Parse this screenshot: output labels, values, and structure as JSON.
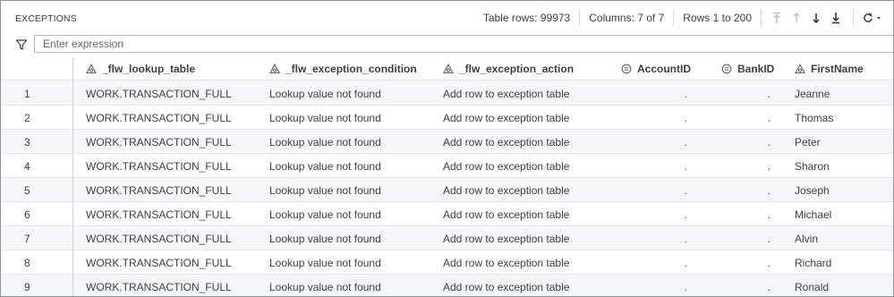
{
  "panel": {
    "title": "EXCEPTIONS",
    "table_rows": "Table rows: 99973",
    "columns": "Columns: 7 of 7",
    "rows_range": "Rows 1 to 200",
    "nav_icons": [
      "first-page-icon",
      "previous-page-icon",
      "next-page-icon",
      "last-page-icon"
    ],
    "refresh_icon": "refresh-icon"
  },
  "filter": {
    "icon": "filter-icon",
    "placeholder": "Enter expression",
    "value": ""
  },
  "columns": [
    {
      "name": "_flw_lookup_table",
      "type": "character"
    },
    {
      "name": "_flw_exception_condition",
      "type": "character"
    },
    {
      "name": "_flw_exception_action",
      "type": "character"
    },
    {
      "name": "AccountID",
      "type": "numeric"
    },
    {
      "name": "BankID",
      "type": "numeric"
    },
    {
      "name": "FirstName",
      "type": "character"
    }
  ],
  "rows": [
    {
      "n": "1",
      "lookup": "WORK.TRANSACTION_FULL",
      "condition": "Lookup value not found",
      "action": "Add row to exception table",
      "account": ".",
      "bank": ".",
      "first": "Jeanne"
    },
    {
      "n": "2",
      "lookup": "WORK.TRANSACTION_FULL",
      "condition": "Lookup value not found",
      "action": "Add row to exception table",
      "account": ".",
      "bank": ".",
      "first": "Thomas"
    },
    {
      "n": "3",
      "lookup": "WORK.TRANSACTION_FULL",
      "condition": "Lookup value not found",
      "action": "Add row to exception table",
      "account": ".",
      "bank": ".",
      "first": "Peter"
    },
    {
      "n": "4",
      "lookup": "WORK.TRANSACTION_FULL",
      "condition": "Lookup value not found",
      "action": "Add row to exception table",
      "account": ".",
      "bank": ".",
      "first": "Sharon"
    },
    {
      "n": "5",
      "lookup": "WORK.TRANSACTION_FULL",
      "condition": "Lookup value not found",
      "action": "Add row to exception table",
      "account": ".",
      "bank": ".",
      "first": "Joseph"
    },
    {
      "n": "6",
      "lookup": "WORK.TRANSACTION_FULL",
      "condition": "Lookup value not found",
      "action": "Add row to exception table",
      "account": ".",
      "bank": ".",
      "first": "Michael"
    },
    {
      "n": "7",
      "lookup": "WORK.TRANSACTION_FULL",
      "condition": "Lookup value not found",
      "action": "Add row to exception table",
      "account": ".",
      "bank": ".",
      "first": "Alvin"
    },
    {
      "n": "8",
      "lookup": "WORK.TRANSACTION_FULL",
      "condition": "Lookup value not found",
      "action": "Add row to exception table",
      "account": ".",
      "bank": ".",
      "first": "Richard"
    },
    {
      "n": "9",
      "lookup": "WORK.TRANSACTION_FULL",
      "condition": "Lookup value not found",
      "action": "Add row to exception table",
      "account": ".",
      "bank": ".",
      "first": "Ronald"
    }
  ]
}
